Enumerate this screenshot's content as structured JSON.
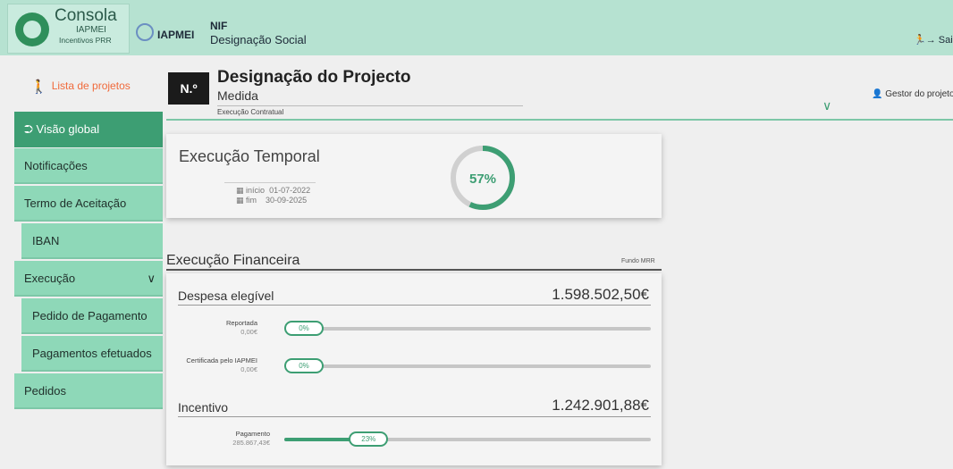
{
  "header": {
    "logo_title": "Consola",
    "logo_org": "IAPMEI",
    "logo_sub": "Incentivos PRR",
    "brand": "IAPMEI",
    "nif_label": "NIF",
    "designacao_social": "Designação Social",
    "exit_label": "Sair",
    "exit_icon": "exit-icon"
  },
  "sidebar": {
    "project_list_label": "Lista de projetos",
    "items": [
      {
        "label": "Visão global",
        "active": true
      },
      {
        "label": "Notificações"
      },
      {
        "label": "Termo de Aceitação"
      },
      {
        "label": "IBAN"
      },
      {
        "label": "Execução"
      },
      {
        "label": "Pedido de Pagamento"
      },
      {
        "label": "Pagamentos efetuados"
      },
      {
        "label": "Pedidos"
      }
    ]
  },
  "project": {
    "number_label": "N.º",
    "title": "Designação do Projecto",
    "medida": "Medida",
    "execucao_contratual": "Execução Contratual",
    "gestor_label": "Gestor do projeto"
  },
  "temporal": {
    "title": "Execução Temporal",
    "start_label": "início",
    "start_date": "01-07-2022",
    "end_label": "fim",
    "end_date": "30-09-2025",
    "percent": 57,
    "percent_label": "57%"
  },
  "financeira": {
    "title": "Execução Financeira",
    "fund_label": "Fundo MRR",
    "despesa": {
      "label": "Despesa elegível",
      "value": "1.598.502,50€",
      "bars": [
        {
          "label": "Reportada",
          "amount": "0,00€",
          "percent": 0,
          "percent_label": "0%"
        },
        {
          "label": "Certificada pelo IAPMEI",
          "amount": "0,00€",
          "percent": 0,
          "percent_label": "0%"
        }
      ]
    },
    "incentivo": {
      "label": "Incentivo",
      "value": "1.242.901,88€",
      "bars": [
        {
          "label": "Pagamento",
          "amount": "285.867,43€",
          "percent": 23,
          "percent_label": "23%"
        }
      ]
    }
  },
  "colors": {
    "accent": "#3d9e73",
    "sidebar": "#8ed8b8",
    "header": "#b6e2d1",
    "link": "#f06a3b"
  }
}
